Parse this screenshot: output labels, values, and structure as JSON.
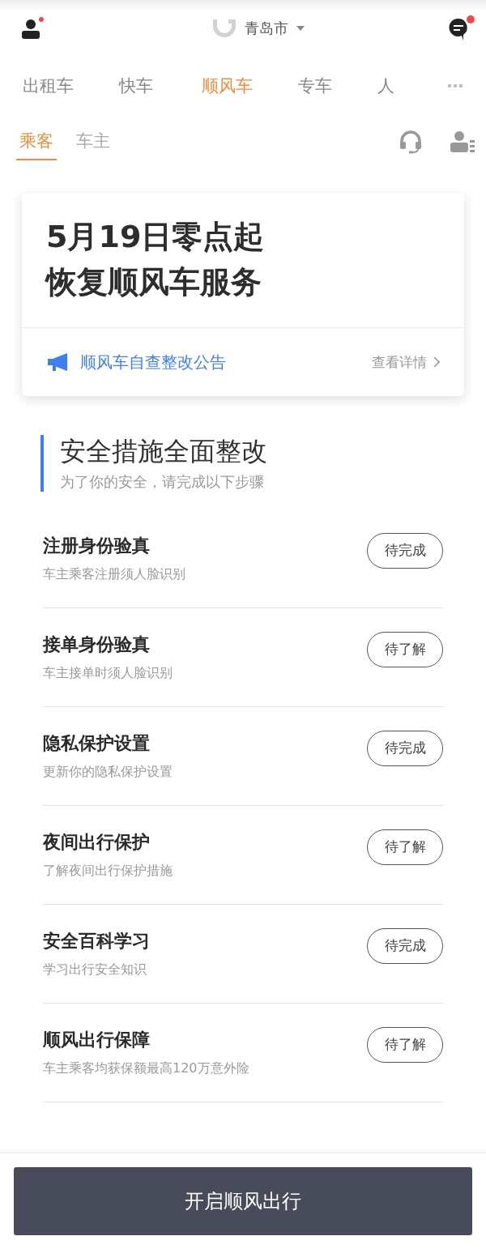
{
  "header": {
    "city": "青岛市",
    "profile_badge": true,
    "message_badge": true
  },
  "service_tabs": [
    {
      "label": "出租车",
      "selected": false
    },
    {
      "label": "快车",
      "selected": false
    },
    {
      "label": "顺风车",
      "selected": true
    },
    {
      "label": "专车",
      "selected": false
    },
    {
      "label": "人",
      "selected": false
    }
  ],
  "role_tabs": [
    {
      "label": "乘客",
      "selected": true
    },
    {
      "label": "车主",
      "selected": false
    }
  ],
  "announcement": {
    "headline": [
      "5月19日零点起",
      "恢复顺风车服务"
    ],
    "notice": "顺风车自查整改公告",
    "details_link": "查看详情"
  },
  "section": {
    "title": "安全措施全面整改",
    "subtitle": "为了你的安全，请完成以下步骤"
  },
  "steps": [
    {
      "title": "注册身份验真",
      "description": "车主乘客注册须人脸识别",
      "status": "待完成"
    },
    {
      "title": "接单身份验真",
      "description": "车主接单时须人脸识别",
      "status": "待了解"
    },
    {
      "title": "隐私保护设置",
      "description": "更新你的隐私保护设置",
      "status": "待完成"
    },
    {
      "title": "夜间出行保护",
      "description": "了解夜间出行保护措施",
      "status": "待了解"
    },
    {
      "title": "安全百科学习",
      "description": "学习出行安全知识",
      "status": "待完成"
    },
    {
      "title": "顺风出行保障",
      "description": "车主乘客均获保额最高120万意外险",
      "status": "待了解"
    }
  ],
  "primary_button": "开启顺风出行"
}
